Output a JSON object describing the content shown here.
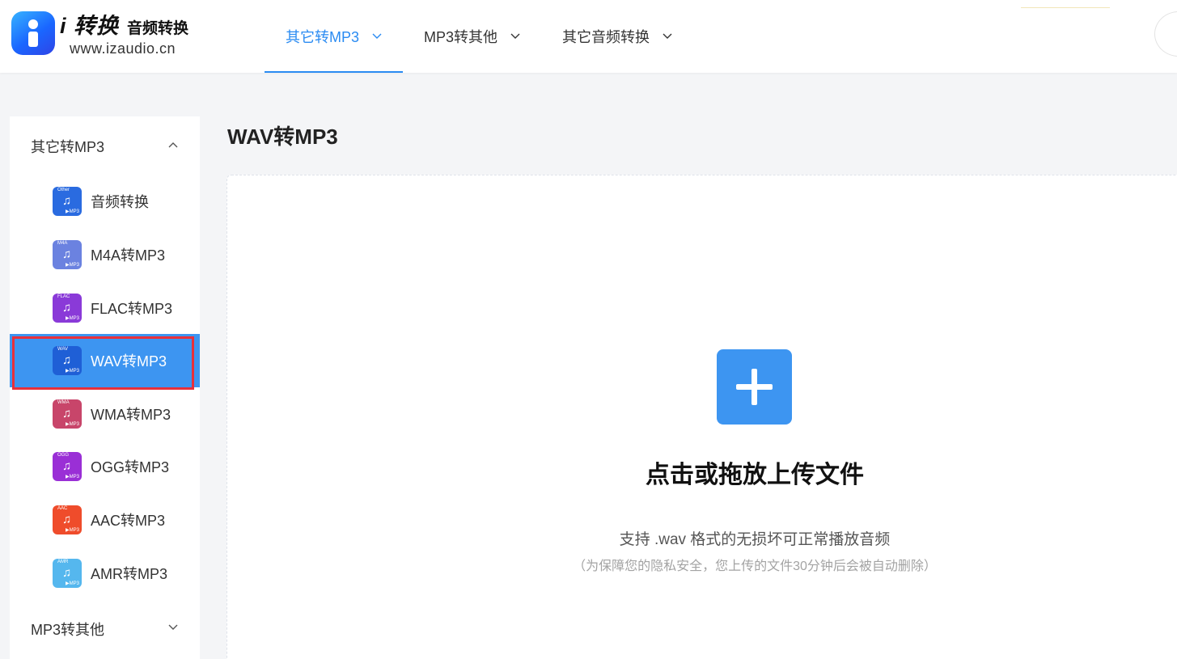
{
  "header": {
    "logo": {
      "main": "i 转换",
      "sub": "音频转换",
      "url": "www.izaudio.cn"
    },
    "nav": [
      {
        "label": "其它转MP3",
        "active": true
      },
      {
        "label": "MP3转其他",
        "active": false
      },
      {
        "label": "其它音频转换",
        "active": false
      }
    ]
  },
  "sidebar": {
    "groups": [
      {
        "label": "其它转MP3",
        "expanded": true
      },
      {
        "label": "MP3转其他",
        "expanded": false
      }
    ],
    "items": [
      {
        "label": "音频转换",
        "tag": "Other",
        "color": "#2a6be0",
        "active": false
      },
      {
        "label": "M4A转MP3",
        "tag": "M4A",
        "color": "#6b82e0",
        "active": false
      },
      {
        "label": "FLAC转MP3",
        "tag": "FLAC",
        "color": "#8a3ad8",
        "active": false
      },
      {
        "label": "WAV转MP3",
        "tag": "WAV",
        "color": "#1f5fd6",
        "active": true
      },
      {
        "label": "WMA转MP3",
        "tag": "WMA",
        "color": "#c8456a",
        "active": false
      },
      {
        "label": "OGG转MP3",
        "tag": "OGG",
        "color": "#9a2fd6",
        "active": false
      },
      {
        "label": "AAC转MP3",
        "tag": "AAC",
        "color": "#ef4c2b",
        "active": false
      },
      {
        "label": "AMR转MP3",
        "tag": "AMR",
        "color": "#55b7ee",
        "active": false
      }
    ],
    "icon_note": "♫",
    "icon_target": "▶MP3"
  },
  "main": {
    "title": "WAV转MP3",
    "upload": {
      "title": "点击或拖放上传文件",
      "desc": "支持 .wav 格式的无损坏可正常播放音频",
      "note": "（为保障您的隐私安全，您上传的文件30分钟后会被自动删除）"
    }
  },
  "colors": {
    "accent": "#2a8bf2",
    "button": "#3d95f1",
    "highlight_border": "#e8303b"
  }
}
